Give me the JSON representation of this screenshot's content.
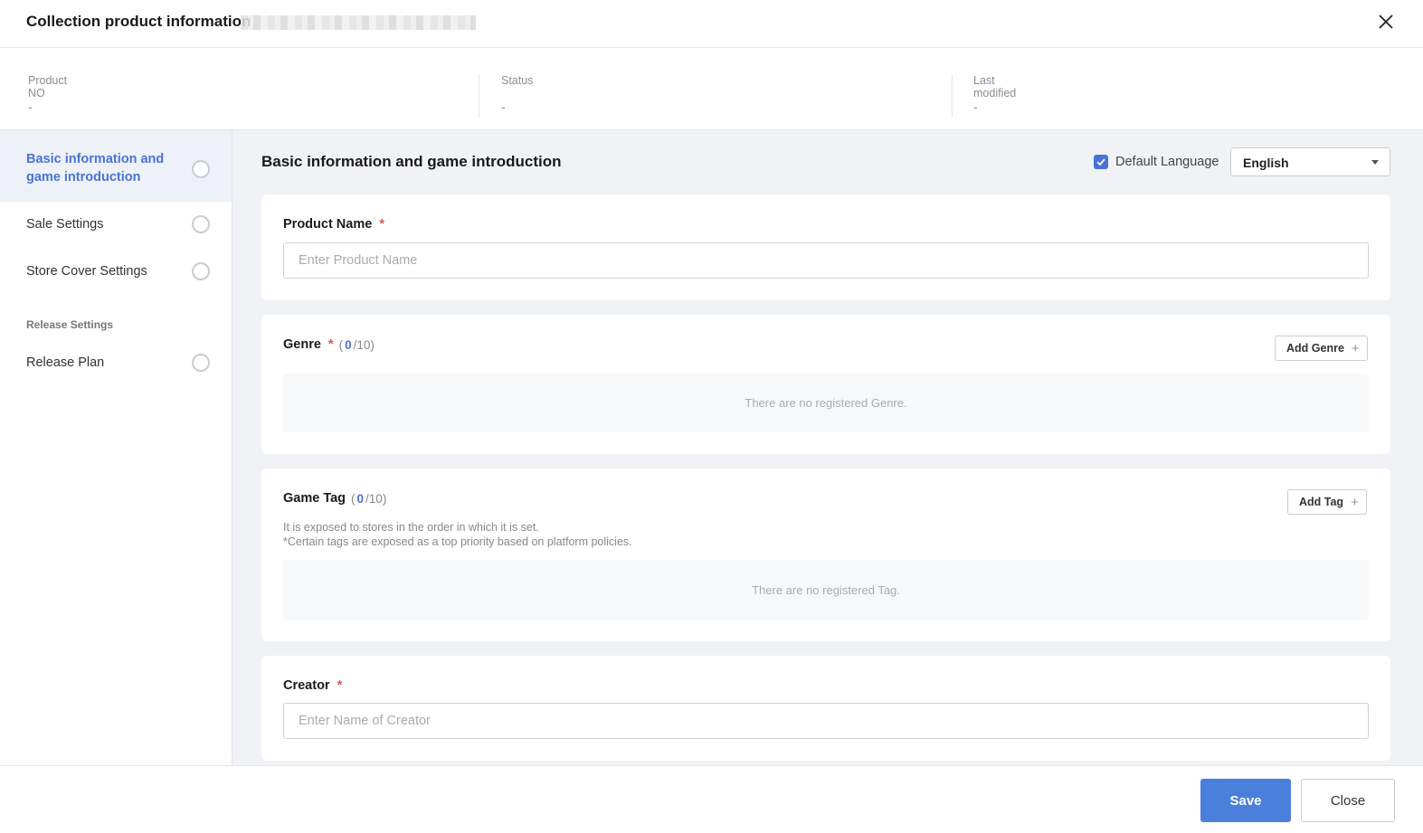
{
  "header": {
    "title": "Collection product information",
    "close_icon": "close-icon"
  },
  "info": {
    "product_no_label": "Product NO",
    "product_no_value": "-",
    "status_label": "Status",
    "status_value": "-",
    "last_modified_label": "Last modified",
    "last_modified_value": "-"
  },
  "sidebar": {
    "items": [
      {
        "label": "Basic information and game introduction",
        "active": true
      },
      {
        "label": "Sale Settings",
        "active": false
      },
      {
        "label": "Store Cover Settings",
        "active": false
      }
    ],
    "section_title": "Release Settings",
    "section_items": [
      {
        "label": "Release Plan",
        "active": false
      }
    ]
  },
  "main": {
    "title": "Basic information and game introduction",
    "default_language_label": "Default Language",
    "default_language_checked": true,
    "language_selected": "English",
    "accent_color": "#4a73d9",
    "product_name": {
      "label": "Product Name",
      "required": "*",
      "placeholder": "Enter Product Name",
      "value": ""
    },
    "genre": {
      "label": "Genre",
      "required": "*",
      "count_open": "(",
      "count": "0",
      "count_max": "/10)",
      "add_label": "Add Genre",
      "empty_text": "There are no registered Genre."
    },
    "game_tag": {
      "label": "Game Tag",
      "count_open": "(",
      "count": "0",
      "count_max": "/10)",
      "add_label": "Add Tag",
      "desc_line1": "It is exposed to stores in the order in which it is set.",
      "desc_line2": "*Certain tags are exposed as a top priority based on platform policies.",
      "empty_text": "There are no registered Tag."
    },
    "creator": {
      "label": "Creator",
      "required": "*",
      "placeholder": "Enter Name of Creator",
      "value": ""
    }
  },
  "footer": {
    "save_label": "Save",
    "close_label": "Close",
    "save_color": "#4a7fdc"
  }
}
